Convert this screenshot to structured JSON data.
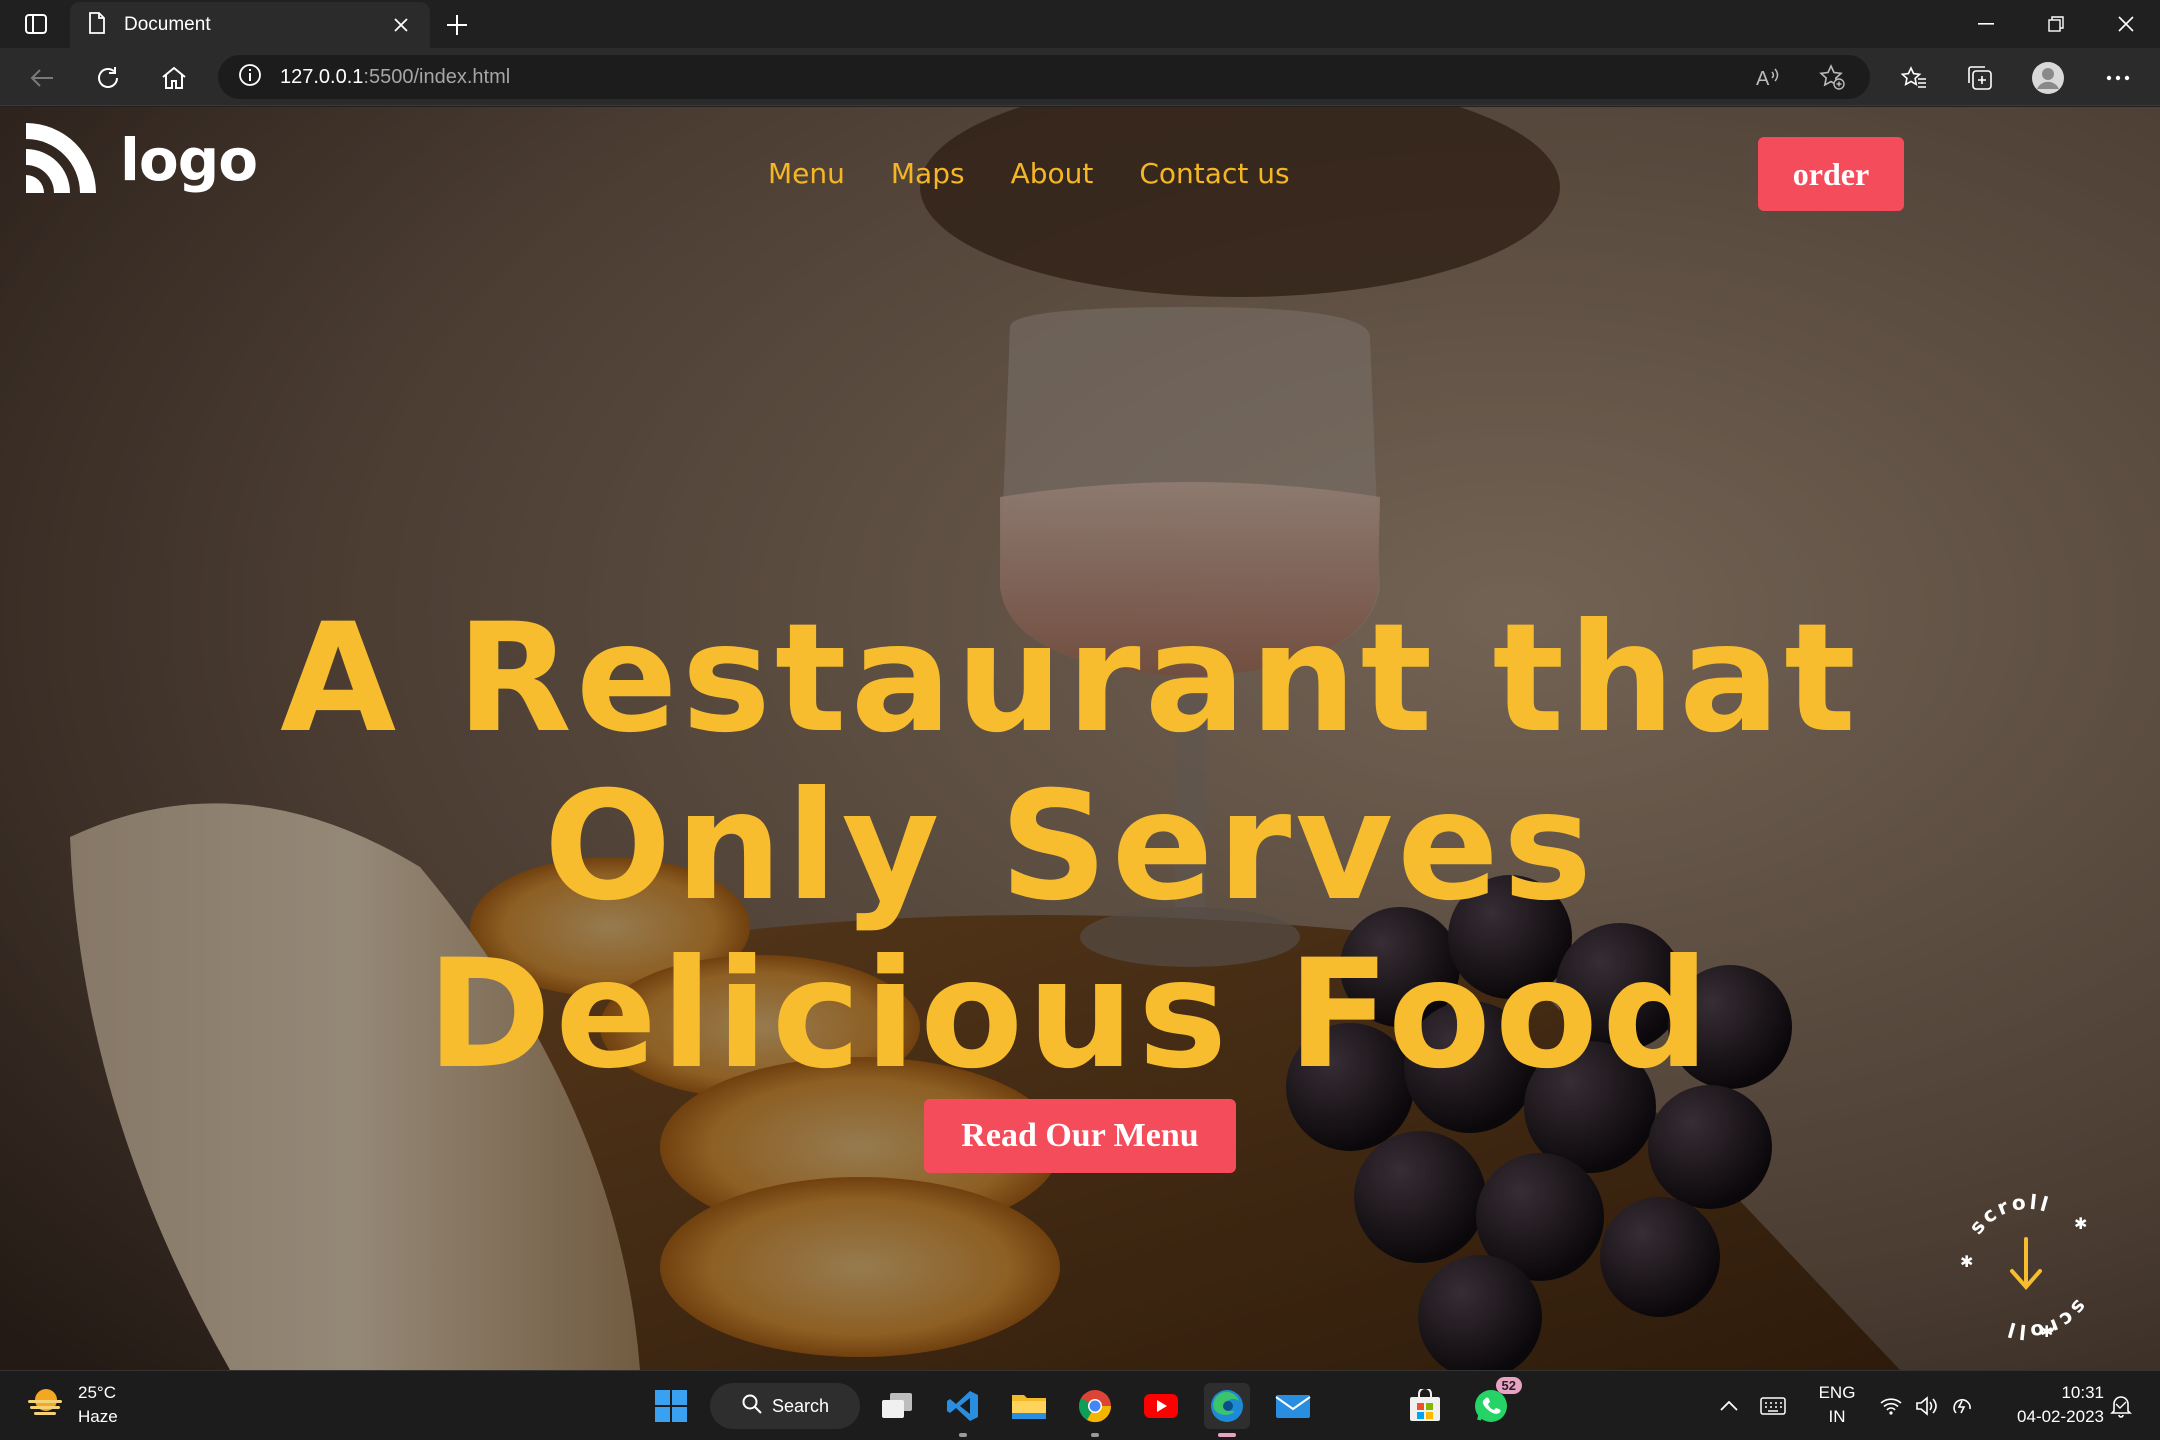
{
  "browser": {
    "tab_title": "Document",
    "url_host": "127.0.0.1",
    "url_path": ":5500/index.html"
  },
  "site": {
    "logo_text": "logo",
    "nav": [
      "Menu",
      "Maps",
      "About",
      "Contact us"
    ],
    "order_label": "order",
    "hero_lines": [
      "A Restaurant that",
      "Only Serves",
      "Delicious Food"
    ],
    "cta_label": "Read Our Menu",
    "scroll_text": "scroll",
    "accent_color": "#f7bd2e",
    "button_color": "#f54c5c"
  },
  "taskbar": {
    "weather_temp": "25°C",
    "weather_desc": "Haze",
    "search_label": "Search",
    "whatsapp_badge": "52",
    "lang_line1": "ENG",
    "lang_line2": "IN",
    "time": "10:31",
    "date": "04-02-2023"
  }
}
